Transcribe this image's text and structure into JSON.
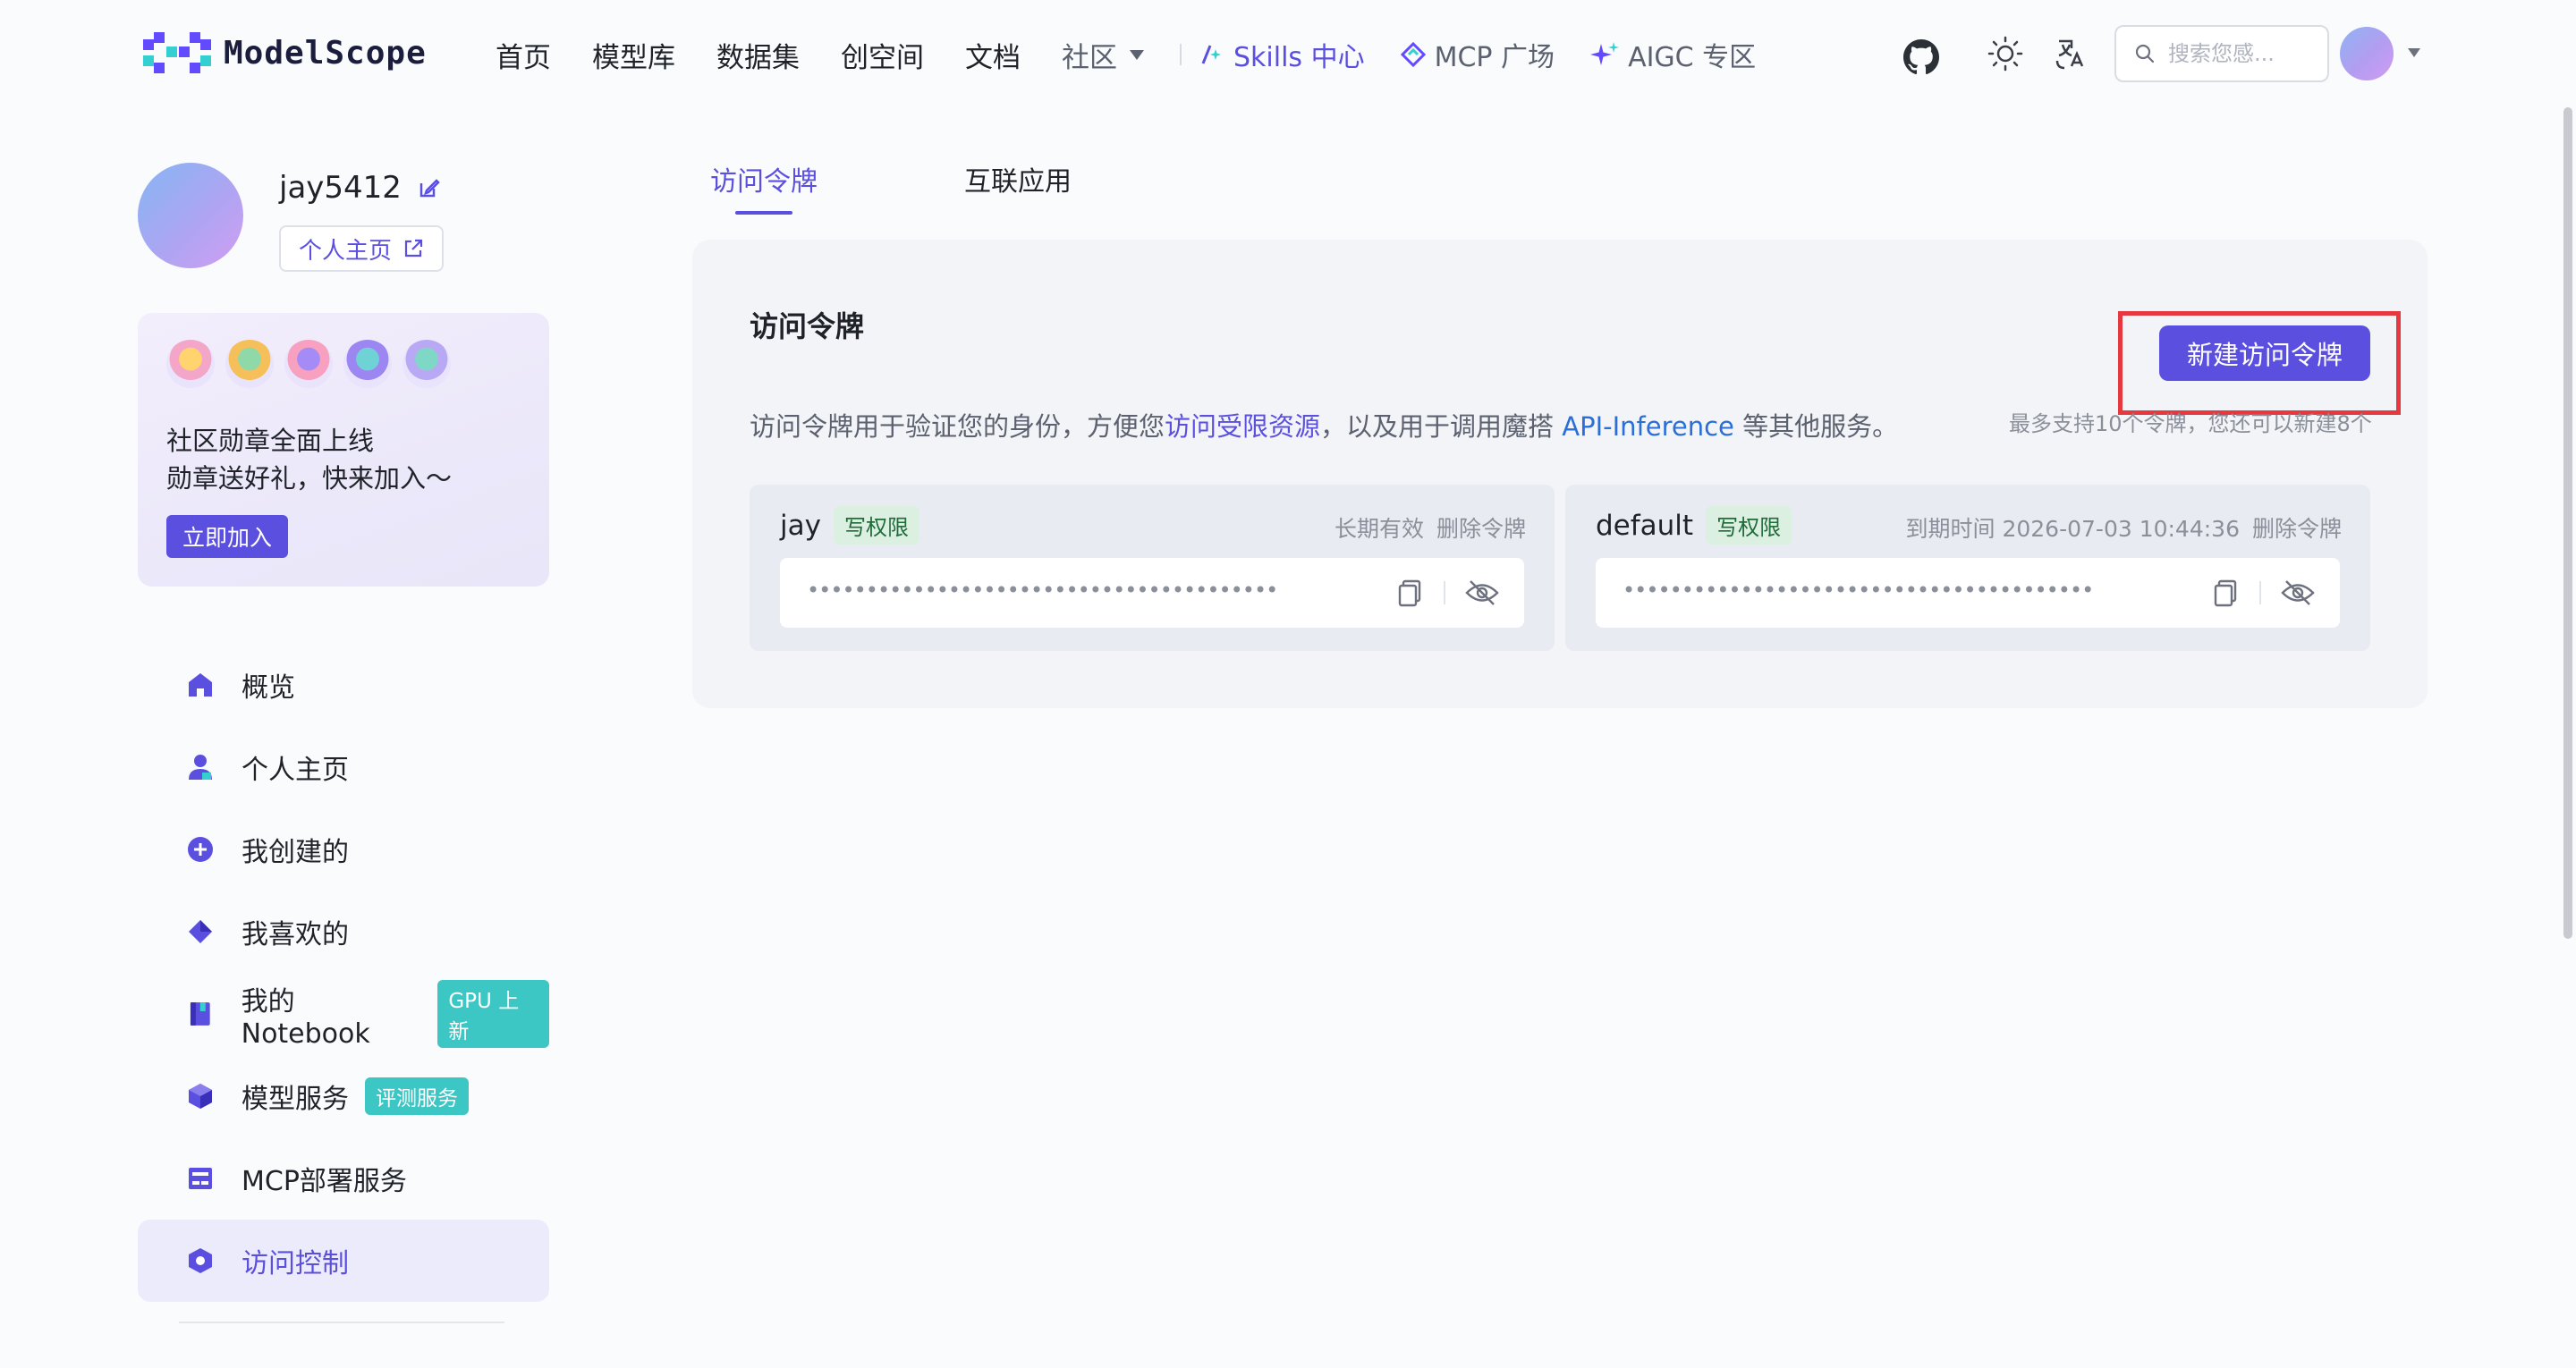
{
  "brand": {
    "logo_text": "ModelScope"
  },
  "nav": {
    "links": [
      "首页",
      "模型库",
      "数据集",
      "创空间",
      "文档"
    ],
    "community": "社区",
    "skills": "Skills 中心",
    "mcp": "MCP 广场",
    "aigc": "AIGC 专区"
  },
  "search": {
    "placeholder": "搜索您感..."
  },
  "profile": {
    "username": "jay5412",
    "homepage_label": "个人主页"
  },
  "promo": {
    "line1": "社区勋章全面上线",
    "line2": "勋章送好礼，快来加入～",
    "button": "立即加入"
  },
  "sidebar": {
    "items": [
      {
        "label": "概览",
        "icon": "home-icon"
      },
      {
        "label": "个人主页",
        "icon": "user-icon"
      },
      {
        "label": "我创建的",
        "icon": "plus-circle-icon"
      },
      {
        "label": "我喜欢的",
        "icon": "diamond-icon"
      },
      {
        "label": "我的Notebook",
        "icon": "notebook-icon",
        "tag": "GPU 上新"
      },
      {
        "label": "模型服务",
        "icon": "cube-icon",
        "tag": "评测服务"
      },
      {
        "label": "MCP部署服务",
        "icon": "server-icon"
      },
      {
        "label": "访问控制",
        "icon": "shield-icon",
        "active": true
      }
    ]
  },
  "tabs": [
    {
      "label": "访问令牌",
      "active": true
    },
    {
      "label": "互联应用",
      "active": false
    }
  ],
  "token_panel": {
    "title": "访问令牌",
    "new_button": "新建访问令牌",
    "desc_prefix": "访问令牌用于验证您的身份，方便您",
    "desc_link1": "访问受限资源",
    "desc_mid": "，以及用于调用魔搭 ",
    "desc_link2": "API-Inference",
    "desc_suffix": " 等其他服务。",
    "limit_text": "最多支持10个令牌，您还可以新建8个",
    "tokens": [
      {
        "name": "jay",
        "permission": "写权限",
        "validity": "长期有效",
        "delete": "删除令牌",
        "masked": "••••••••••••••••••••••••••••••••••••••••"
      },
      {
        "name": "default",
        "permission": "写权限",
        "validity": "到期时间 2026-07-03 10:44:36",
        "delete": "删除令牌",
        "masked": "••••••••••••••••••••••••••••••••••••••••"
      }
    ]
  },
  "colors": {
    "accent": "#5b4fe0",
    "highlight": "#e5393f",
    "tag": "#3cc6c4"
  }
}
